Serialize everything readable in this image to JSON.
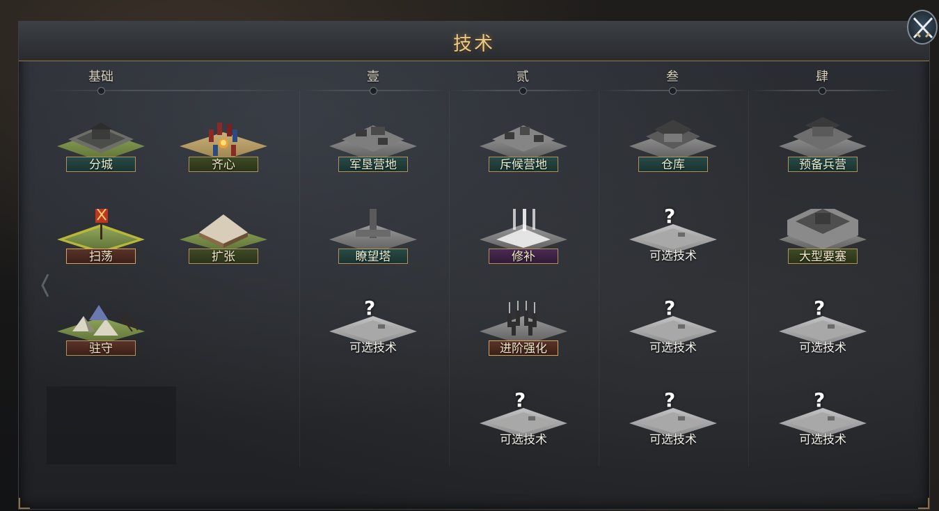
{
  "title": "技术",
  "columns": [
    {
      "key": "base",
      "label": "基础"
    },
    {
      "key": "one",
      "label": "壹"
    },
    {
      "key": "two",
      "label": "贰"
    },
    {
      "key": "three",
      "label": "叁"
    },
    {
      "key": "four",
      "label": "肆"
    }
  ],
  "tiles": {
    "fencheng": {
      "label": "分城",
      "style": "teal",
      "art": "city"
    },
    "qixin": {
      "label": "齐心",
      "style": "olive",
      "art": "camp-fire"
    },
    "saodang": {
      "label": "扫荡",
      "style": "brown",
      "art": "banner"
    },
    "kuozhang": {
      "label": "扩张",
      "style": "olive",
      "art": "tent-house"
    },
    "zhushou": {
      "label": "驻守",
      "style": "brown",
      "art": "tents"
    },
    "junken": {
      "label": "军垦营地",
      "style": "teal",
      "art": "gray-camp"
    },
    "liaowang": {
      "label": "瞭望塔",
      "style": "teal",
      "art": "tower"
    },
    "c1_optional": {
      "label": "可选技术",
      "style": "plain",
      "art": "unknown"
    },
    "chihou": {
      "label": "斥候营地",
      "style": "teal",
      "art": "gray-camp"
    },
    "xiubu": {
      "label": "修补",
      "style": "purple",
      "art": "glow"
    },
    "jinjie": {
      "label": "进阶强化",
      "style": "brown",
      "art": "soldiers"
    },
    "c2_optional": {
      "label": "可选技术",
      "style": "plain",
      "art": "unknown"
    },
    "cangku": {
      "label": "仓库",
      "style": "teal",
      "art": "gray-hall"
    },
    "c3_optional1": {
      "label": "可选技术",
      "style": "plain",
      "art": "unknown"
    },
    "c3_optional2": {
      "label": "可选技术",
      "style": "plain",
      "art": "unknown"
    },
    "c3_optional3": {
      "label": "可选技术",
      "style": "plain",
      "art": "unknown"
    },
    "yubei": {
      "label": "预备兵营",
      "style": "teal",
      "art": "gray-hall"
    },
    "daxing": {
      "label": "大型要塞",
      "style": "olive",
      "art": "fortress"
    },
    "c4_optional1": {
      "label": "可选技术",
      "style": "plain",
      "art": "unknown"
    },
    "c4_optional2": {
      "label": "可选技术",
      "style": "plain",
      "art": "unknown"
    }
  },
  "question_mark": "?",
  "colors": {
    "accent": "#e8c98a",
    "border_gold": "#b0935a"
  }
}
